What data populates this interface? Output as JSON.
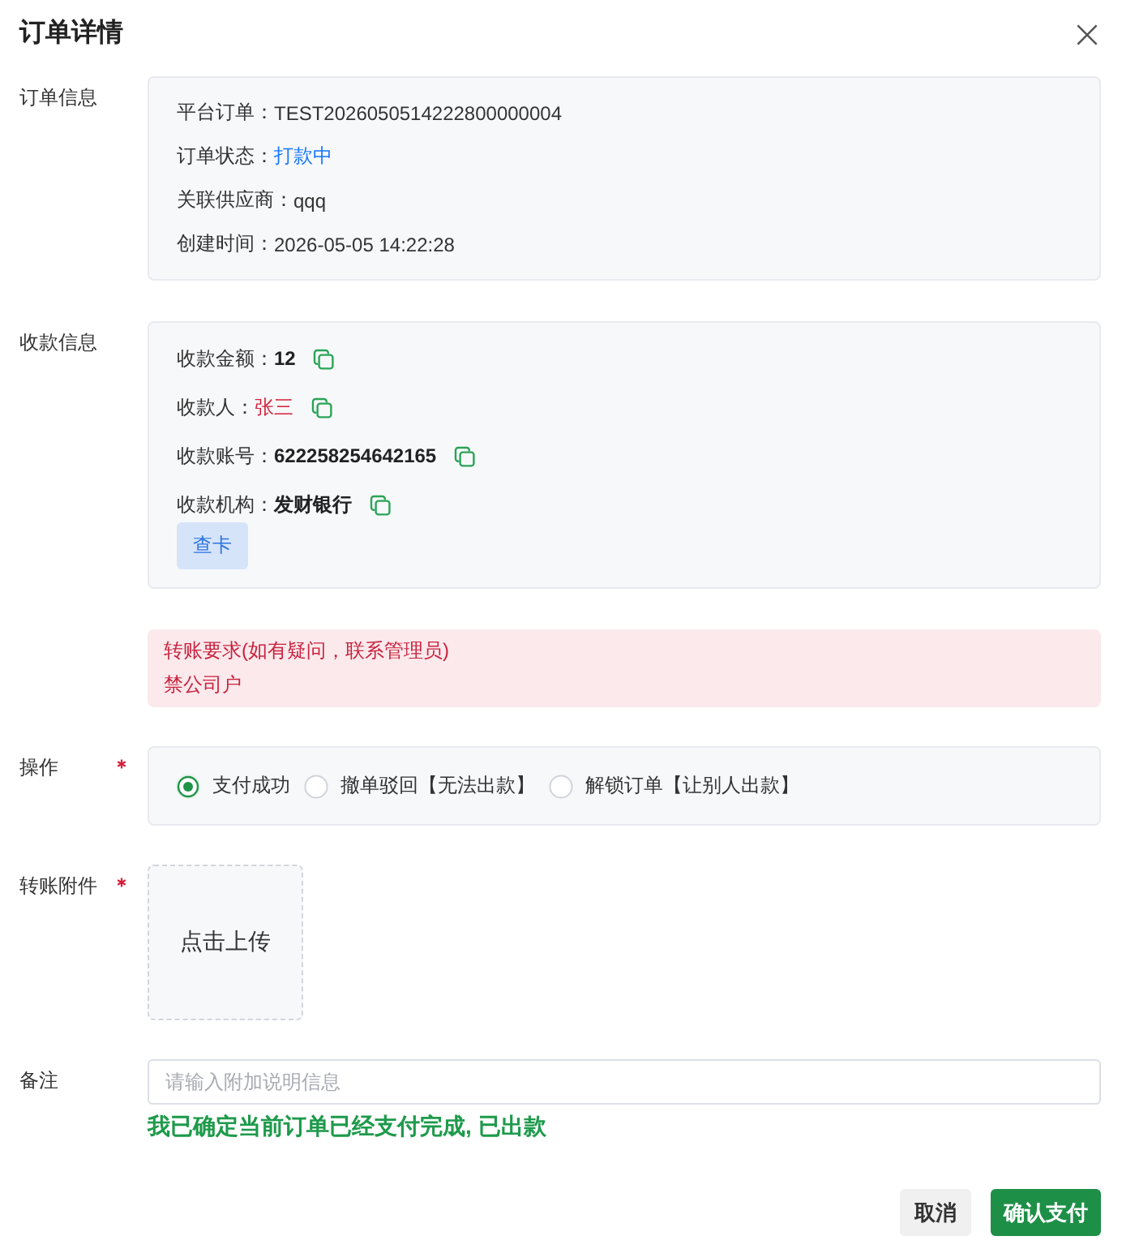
{
  "dialog": {
    "title": "订单详情"
  },
  "order_info": {
    "label": "订单信息",
    "fields": [
      {
        "label": "平台订单：",
        "value": "TEST2026050514222800000004",
        "kind": "text"
      },
      {
        "label": "订单状态：",
        "value": "打款中",
        "kind": "status"
      },
      {
        "label": "关联供应商：",
        "value": "qqq",
        "kind": "text"
      },
      {
        "label": "创建时间：",
        "value": "2026-05-05 14:22:28",
        "kind": "text"
      }
    ]
  },
  "payee_info": {
    "label": "收款信息",
    "fields": [
      {
        "label": "收款金额：",
        "value": "12",
        "kind": "strong",
        "copyable": true
      },
      {
        "label": "收款人：",
        "value": "张三",
        "kind": "alert",
        "copyable": true
      },
      {
        "label": "收款账号：",
        "value": "622258254642165",
        "kind": "strong",
        "copyable": true
      },
      {
        "label": "收款机构：",
        "value": "发财银行",
        "kind": "strong",
        "copyable": true
      }
    ],
    "button": "查卡"
  },
  "notice": {
    "lines": [
      "转账要求(如有疑问，联系管理员)",
      "禁公司户"
    ]
  },
  "operation": {
    "label": "操作",
    "required": true,
    "options": [
      {
        "label": "支付成功",
        "selected": true
      },
      {
        "label": "撤单驳回【无法出款】",
        "selected": false
      },
      {
        "label": "解锁订单【让别人出款】",
        "selected": false
      }
    ]
  },
  "attachment": {
    "label": "转账附件",
    "required": true,
    "upload_text": "点击上传"
  },
  "remark": {
    "label": "备注",
    "placeholder": "请输入附加说明信息",
    "hint": "我已确定当前订单已经支付完成, 已出款"
  },
  "buttons": [
    {
      "label": "取消",
      "kind": "secondary"
    },
    {
      "label": "确认支付",
      "kind": "primary"
    }
  ]
}
